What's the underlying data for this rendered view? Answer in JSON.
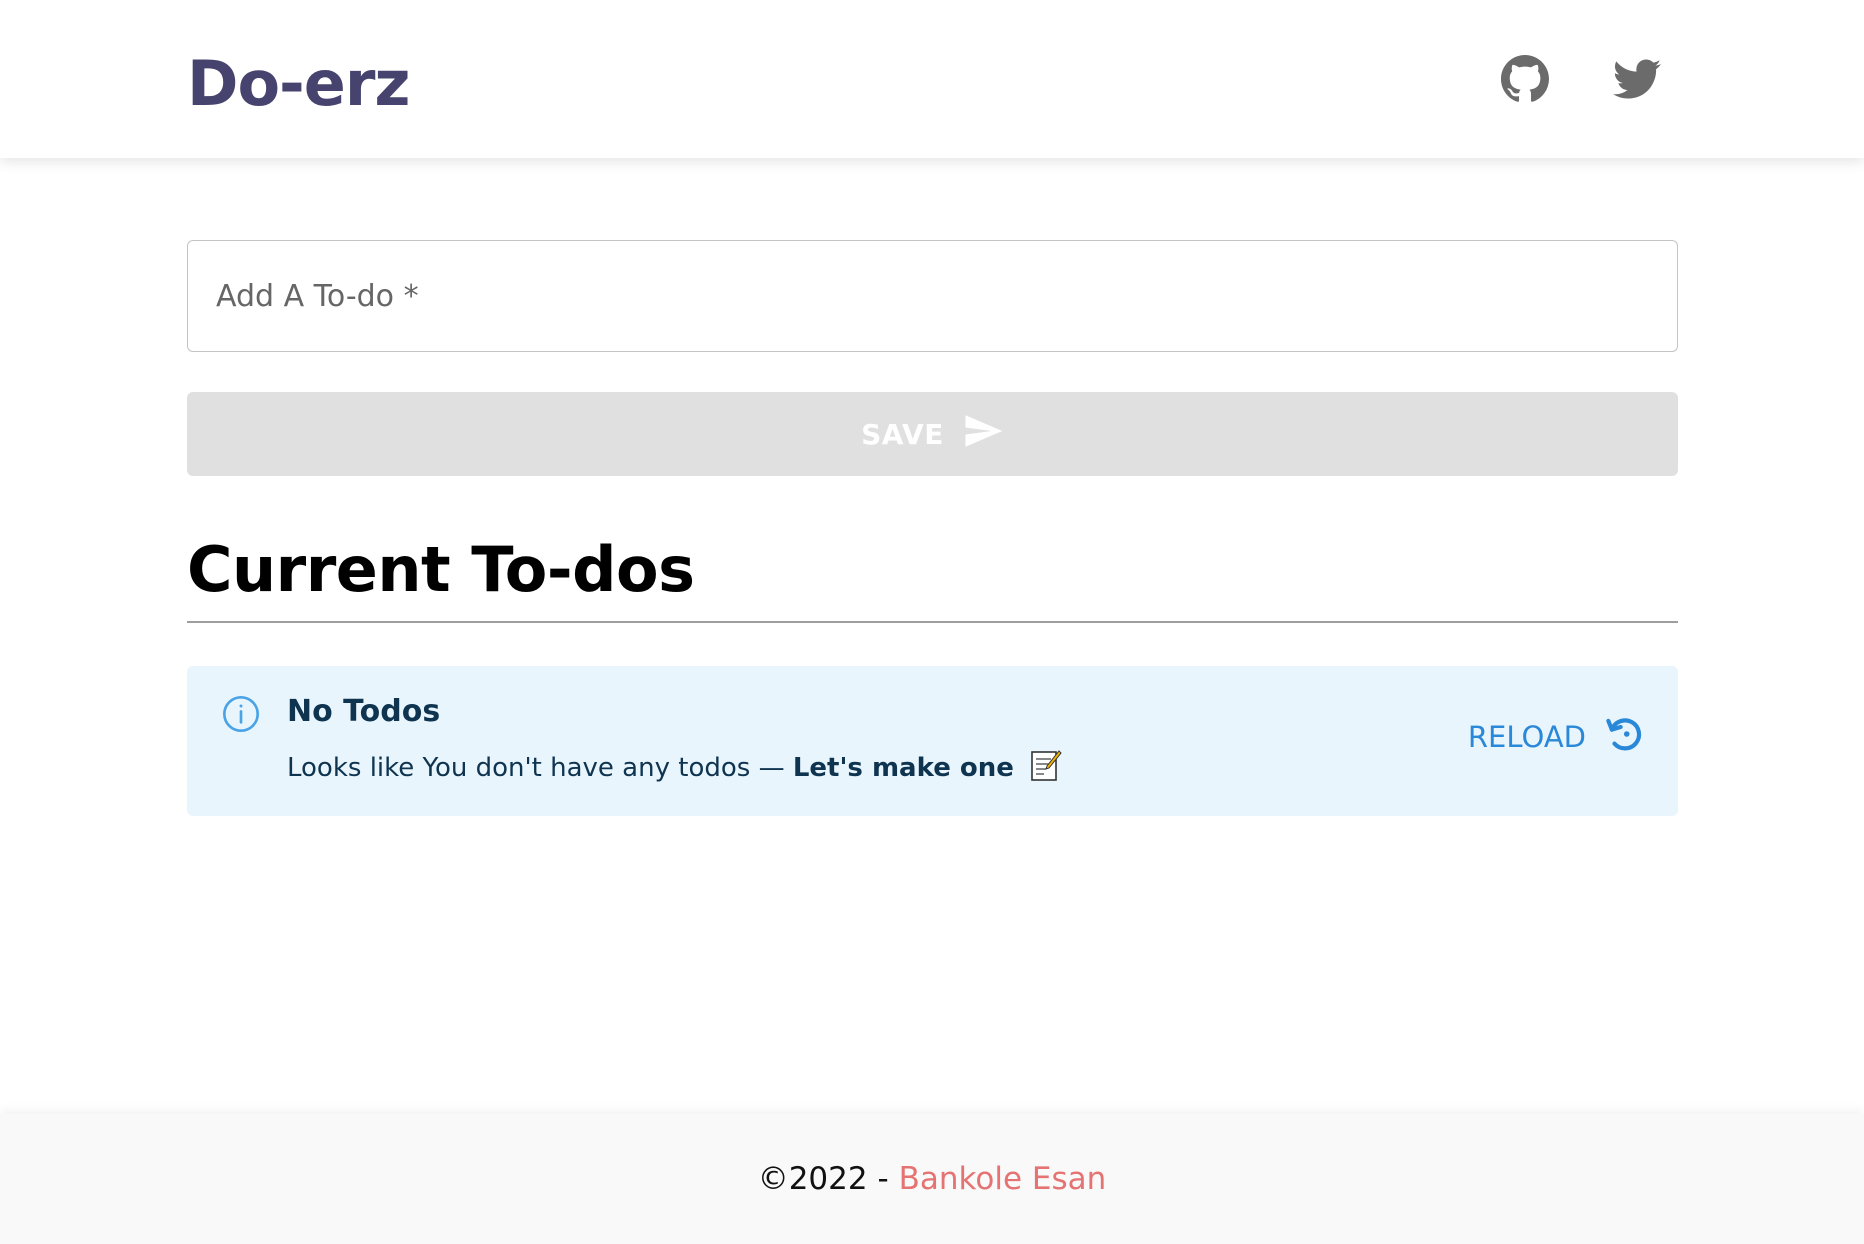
{
  "header": {
    "brand": "Do-erz",
    "icons": [
      "github-icon",
      "twitter-icon"
    ]
  },
  "form": {
    "placeholder": "Add A To-do *",
    "value": "",
    "save_label": "SAVE"
  },
  "section": {
    "title": "Current To-dos"
  },
  "alert": {
    "title": "No Todos",
    "message_prefix": "Looks like You don't have any todos —",
    "message_strong": "Let's make one",
    "reload_label": "RELOAD"
  },
  "footer": {
    "copyright": "©2022 -",
    "author": "Bankole Esan"
  },
  "colors": {
    "brand": "#46446e",
    "alert_bg": "#e9f5fd",
    "alert_text": "#0f3450",
    "reload": "#2a88d8",
    "author": "#e57373",
    "save_disabled_bg": "#e0e0e0"
  }
}
